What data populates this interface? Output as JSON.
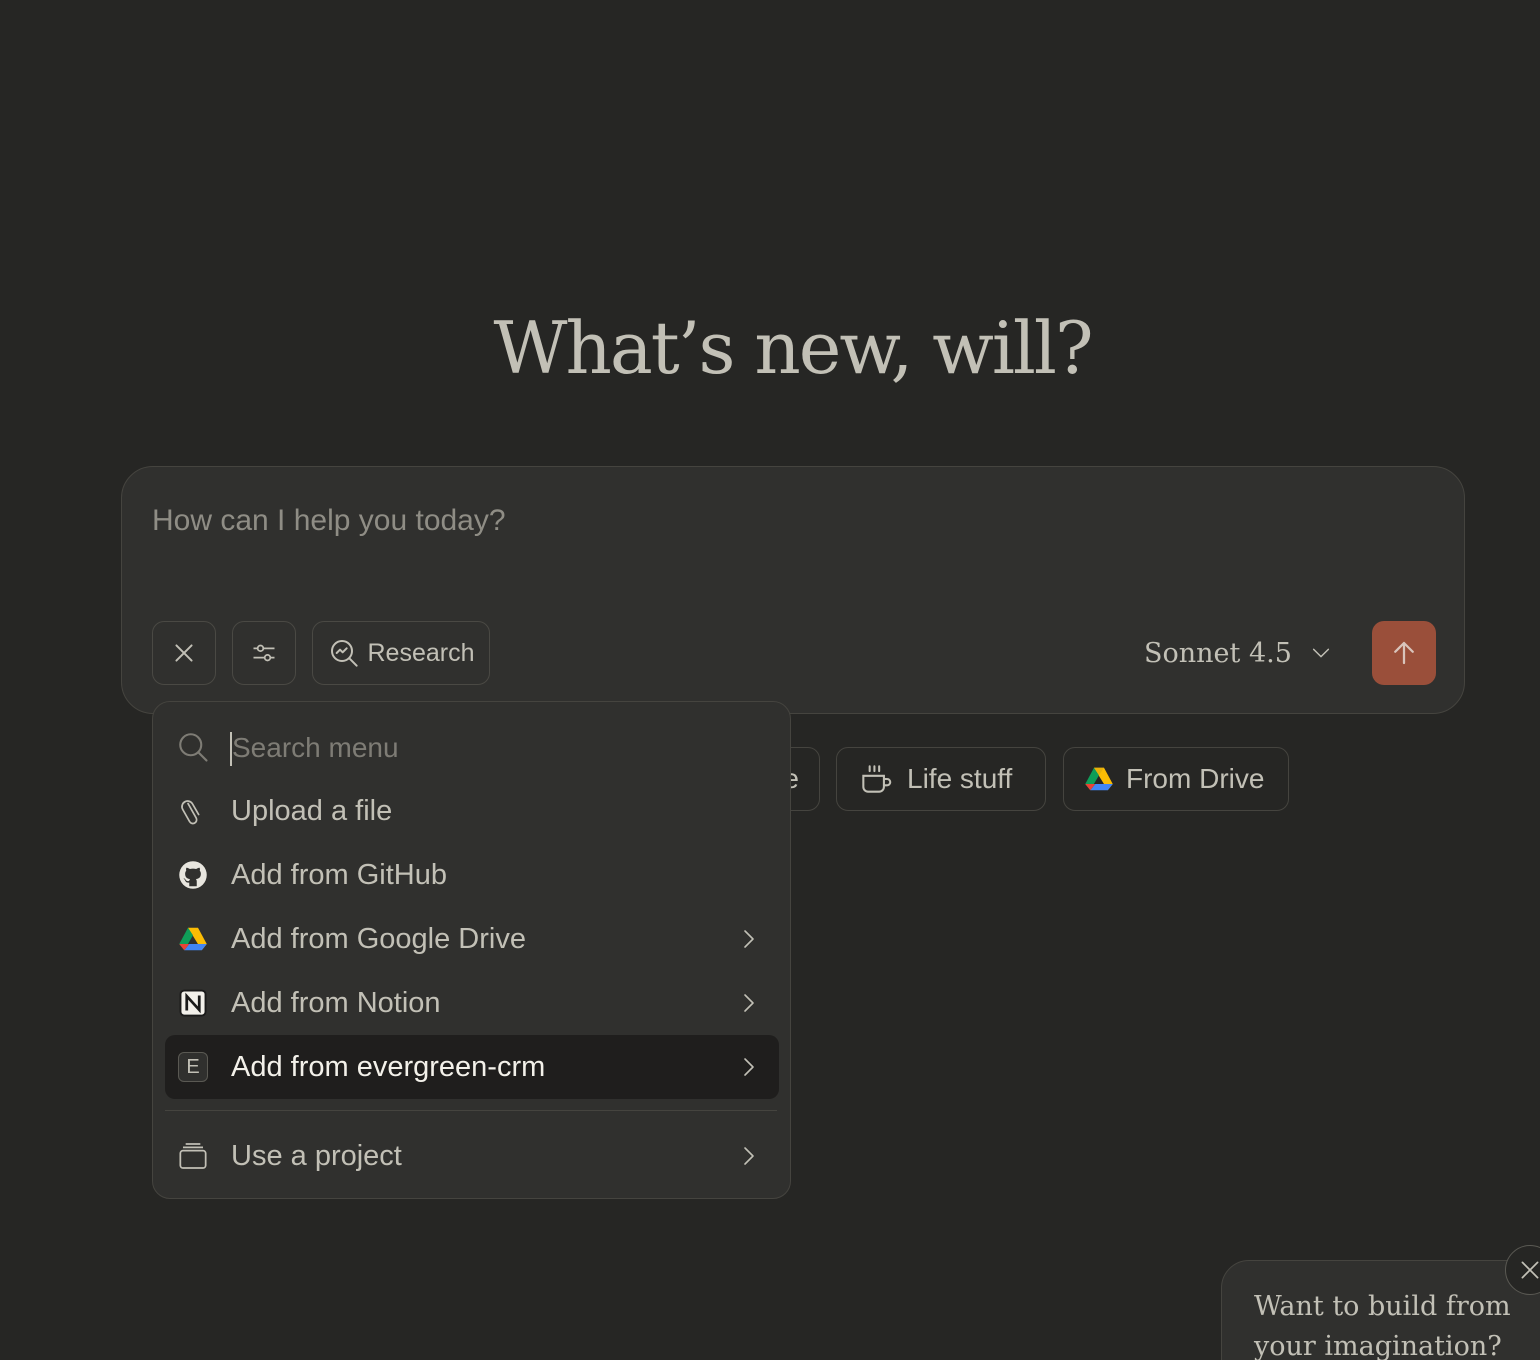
{
  "greeting": "What’s new, will?",
  "composer": {
    "placeholder": "How can I help you today?",
    "research_label": "Research",
    "model": "Sonnet 4.5",
    "accent_color": "#9a4f3a"
  },
  "chips": [
    {
      "label": "e",
      "icon": "none"
    },
    {
      "label": "Life stuff",
      "icon": "coffee-cup-icon"
    },
    {
      "label": "From Drive",
      "icon": "google-drive-icon"
    }
  ],
  "menu": {
    "search_placeholder": "Search menu",
    "items": [
      {
        "label": "Upload a file",
        "icon": "paperclip-icon",
        "has_submenu": false
      },
      {
        "label": "Add from GitHub",
        "icon": "github-icon",
        "has_submenu": false
      },
      {
        "label": "Add from Google Drive",
        "icon": "google-drive-icon",
        "has_submenu": true
      },
      {
        "label": "Add from Notion",
        "icon": "notion-icon",
        "has_submenu": true
      },
      {
        "label": "Add from evergreen-crm",
        "icon": "e-badge-icon",
        "badge": "E",
        "has_submenu": true,
        "active": true
      },
      {
        "label": "Use a project",
        "icon": "project-box-icon",
        "has_submenu": true
      }
    ]
  },
  "promo": {
    "text": "Want to build from your imagination?"
  }
}
